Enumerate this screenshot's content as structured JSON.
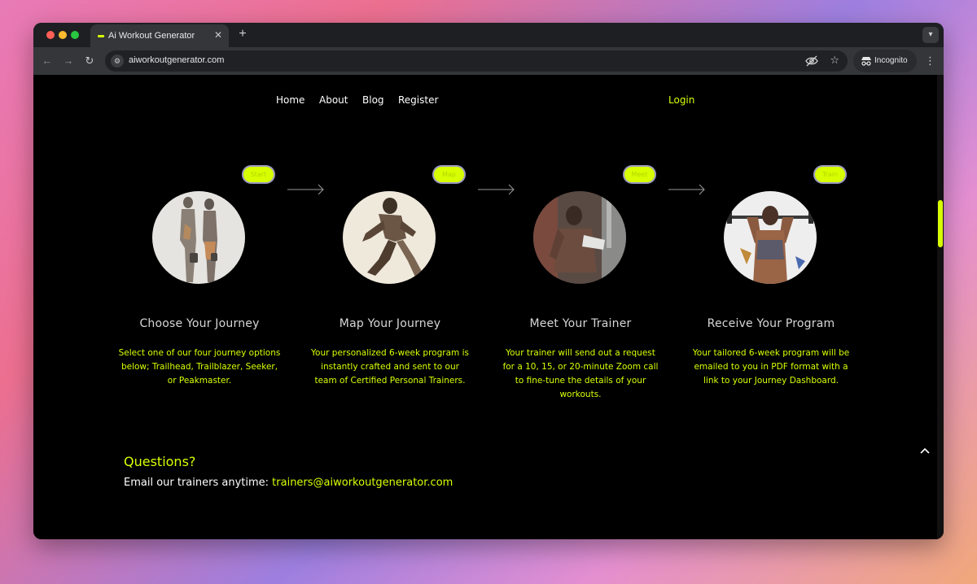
{
  "browser": {
    "tab_title": "Ai Workout Generator",
    "tab_close_icon": "✕",
    "new_tab_icon": "+",
    "url": "aiworkoutgenerator.com",
    "incognito_label": "Incognito"
  },
  "nav": {
    "home": "Home",
    "about": "About",
    "blog": "Blog",
    "register": "Register",
    "login": "Login"
  },
  "steps": [
    {
      "badge": "Start",
      "title": "Choose Your Journey",
      "description": "Select one of our four journey options below; Trailhead, Trailblazer, Seeker, or Peakmaster."
    },
    {
      "badge": "Map",
      "title": "Map Your Journey",
      "description": "Your personalized 6-week program is instantly crafted and sent to our team of Certified Personal Trainers."
    },
    {
      "badge": "Meet",
      "title": "Meet Your Trainer",
      "description": "Your trainer will send out a request for a 10, 15, or 20-minute Zoom call to fine-tune the details of your workouts."
    },
    {
      "badge": "Train",
      "title": "Receive Your Program",
      "description": "Your tailored 6-week program will be emailed to you in PDF format with a link to your Journey Dashboard."
    }
  ],
  "questions": {
    "title": "Questions?",
    "prompt": "Email our trainers anytime:",
    "email": "trainers@aiworkoutgenerator.com"
  },
  "colors": {
    "accent": "#d8ff00",
    "background": "#000000",
    "text": "#ffffff"
  }
}
